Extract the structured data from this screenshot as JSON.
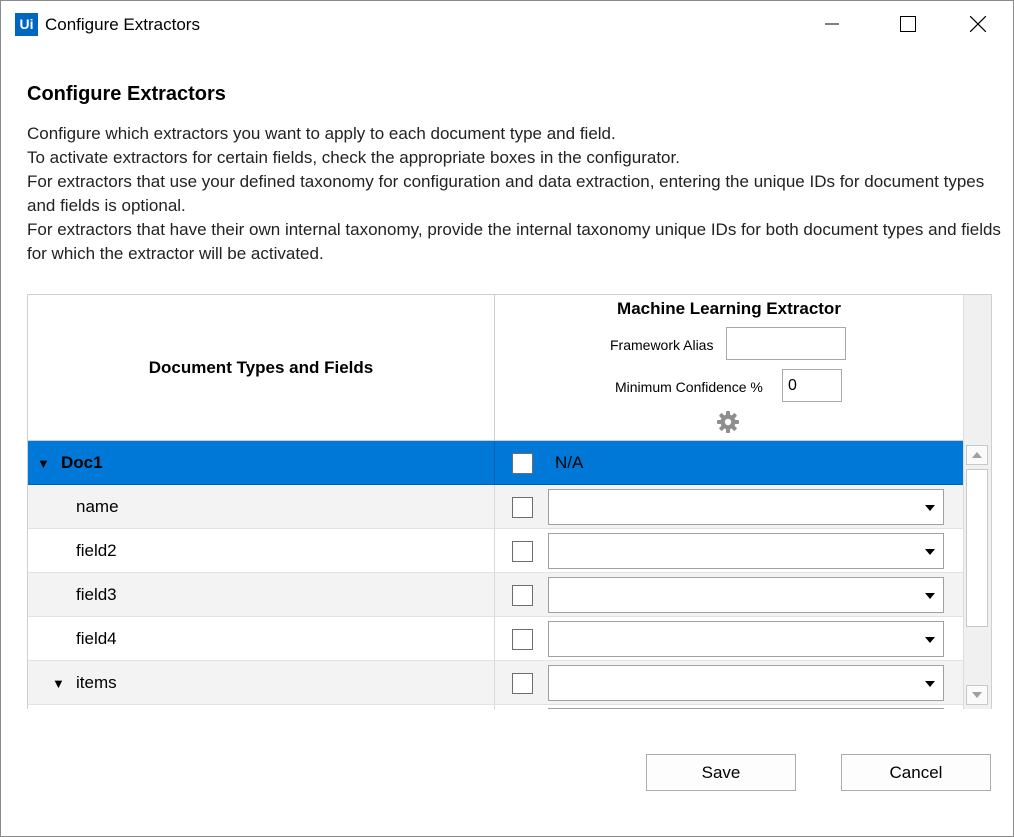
{
  "window": {
    "app_icon_text": "Ui",
    "title": "Configure Extractors",
    "minimize_icon": "minimize-icon",
    "maximize_icon": "maximize-icon",
    "close_icon": "close-icon"
  },
  "heading": "Configure Extractors",
  "description": [
    "Configure which extractors you want to apply to each document type and field.",
    "To activate extractors for certain fields, check the appropriate boxes in the configurator.",
    "For extractors that use your defined taxonomy for configuration and data extraction, entering the unique IDs for document types and fields is optional.",
    "For extractors that have their own internal taxonomy, provide the internal taxonomy unique IDs for both document types and fields for which the extractor will be activated."
  ],
  "grid": {
    "left_header": "Document Types and Fields",
    "extractor": {
      "title": "Machine Learning Extractor",
      "framework_alias_label": "Framework Alias",
      "framework_alias_value": "",
      "min_confidence_label": "Minimum Confidence %",
      "min_confidence_value": "0",
      "settings_icon": "gear-icon"
    },
    "rows": [
      {
        "label": "Doc1",
        "expander": "▼",
        "selected": true,
        "checked": false,
        "value_text": "N/A"
      },
      {
        "label": "name",
        "checked": false,
        "combo_value": ""
      },
      {
        "label": "field2",
        "checked": false,
        "combo_value": ""
      },
      {
        "label": "field3",
        "checked": false,
        "combo_value": ""
      },
      {
        "label": "field4",
        "checked": false,
        "combo_value": ""
      },
      {
        "label": "items",
        "expander": "▼",
        "checked": false,
        "combo_value": ""
      }
    ]
  },
  "buttons": {
    "save": "Save",
    "cancel": "Cancel"
  },
  "colors": {
    "selection": "#0078d7",
    "app_icon": "#0067c0"
  }
}
